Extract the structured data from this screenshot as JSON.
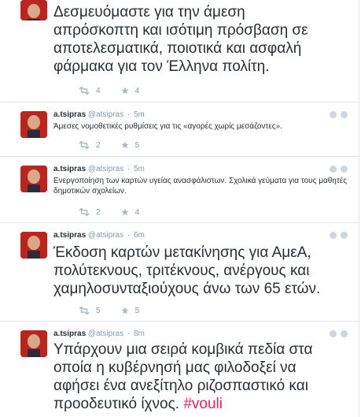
{
  "tweets": [
    {
      "body_lines": [
        "Δεσμευόμαστε για την  άμεση",
        "απρόσκοπτη και ισότιμη πρόσβαση σε",
        "αποτελεσματικά, ποιοτικά και ασφαλή",
        "φάρμακα για τον Έλληνα πολίτη."
      ],
      "retweets": "4",
      "favorites": "4"
    },
    {
      "name": "a.tsipras",
      "handle": "@atsipras",
      "time": "5m",
      "body": "Άμεσες νομοθετικές ρυθμίσεις για τις «αγορές χωρίς μεσάζοντες».",
      "retweets": "2",
      "favorites": "5"
    },
    {
      "name": "a.tsipras",
      "handle": "@atsipras",
      "time": "5m",
      "body": "Ενεργοποίηση των καρτών υγείας ανασφάλιστων. Σχολικά γεύματα για τους μαθητές δημοτικών σχολείων.",
      "retweets": "2",
      "favorites": "4"
    },
    {
      "name": "a.tsipras",
      "handle": "@atsipras",
      "time": "6m",
      "body_lines": [
        "Έκδοση καρτών μετακίνησης για ΑμεΑ,",
        "πολύτεκνους, τριτέκνους, ανέργους και",
        "χαμηλοσυνταξιούχους άνω των 65 ετών."
      ],
      "retweets": "5",
      "favorites": "5"
    },
    {
      "name": "a.tsipras",
      "handle": "@atsipras",
      "time": "8m",
      "body_lines": [
        "Υπάρχουν μια σειρά κομβικά  πεδία στα",
        "οποία η κυβέρνησή μας φιλοδοξεί να",
        "αφήσει ένα ανεξίτηλο ριζοσπαστικό και",
        "προοδευτικό ίχνος."
      ],
      "hashtag": "#vouli"
    }
  ],
  "icons": [
    "avatar-icon",
    "retweet-icon",
    "favorite-icon"
  ],
  "colors": {
    "hashtag": "#e0245e",
    "meta": "#8899a6",
    "text": "#292f33",
    "divider": "#e1e8ed"
  }
}
